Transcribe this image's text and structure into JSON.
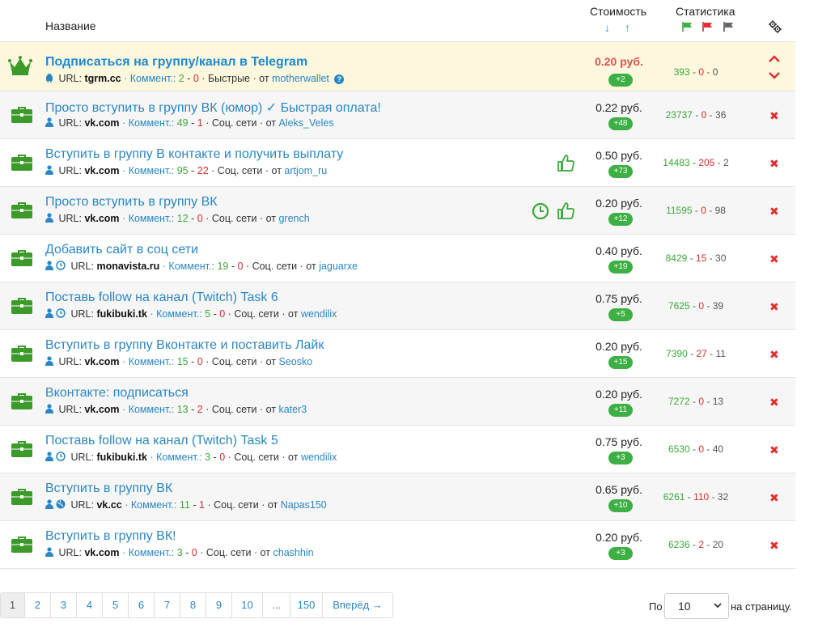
{
  "header": {
    "name_label": "Название",
    "cost_label": "Стоимость",
    "stats_label": "Статистика",
    "sort_down": "↓",
    "sort_up": "↑"
  },
  "promo": {
    "title": "Подписаться на группу/канал в Telegram",
    "url_label": "URL:",
    "url": "tgrm.cc",
    "comments_label": "Коммент.:",
    "comments_good": "2",
    "sep": " - ",
    "comments_bad": "0",
    "category": "Быстрые",
    "from_label": "от",
    "author": "motherwallet",
    "help": "?",
    "price": "0.20 руб.",
    "badge": "+2",
    "stat_ok": "393",
    "stat_bad": "0",
    "stat_neutral": "0"
  },
  "rows": [
    {
      "title": "Просто вступить в группу ВК (юмор) ✓ Быстрая оплата!",
      "url": "vk.com",
      "c_good": "49",
      "c_bad": "1",
      "category": "Соц. сети",
      "author": "Aleks_Veles",
      "price": "0.22 руб.",
      "badge": "+48",
      "s_ok": "23737",
      "s_bad": "0",
      "s_n": "36"
    },
    {
      "title": "Вступить в группу В контакте и получить выплату",
      "url": "vk.com",
      "c_good": "95",
      "c_bad": "22",
      "category": "Соц. сети",
      "author": "artjom_ru",
      "price": "0.50 руб.",
      "badge": "+73",
      "s_ok": "14483",
      "s_bad": "205",
      "s_n": "2"
    },
    {
      "title": "Просто вступить в группу ВК",
      "url": "vk.com",
      "c_good": "12",
      "c_bad": "0",
      "category": "Соц. сети",
      "author": "grench",
      "price": "0.20 руб.",
      "badge": "+12",
      "s_ok": "11595",
      "s_bad": "0",
      "s_n": "98"
    },
    {
      "title": "Добавить сайт в соц сети",
      "url": "monavista.ru",
      "c_good": "19",
      "c_bad": "0",
      "category": "Соц. сети",
      "author": "jaguarxe",
      "price": "0.40 руб.",
      "badge": "+19",
      "s_ok": "8429",
      "s_bad": "15",
      "s_n": "30"
    },
    {
      "title": "Поставь follow на канал (Twitch) Task 6",
      "url": "fukibuki.tk",
      "c_good": "5",
      "c_bad": "0",
      "category": "Соц. сети",
      "author": "wendilix",
      "price": "0.75 руб.",
      "badge": "+5",
      "s_ok": "7625",
      "s_bad": "0",
      "s_n": "39"
    },
    {
      "title": "Вступить в группу Вконтакте и поставить Лайк",
      "url": "vk.com",
      "c_good": "15",
      "c_bad": "0",
      "category": "Соц. сети",
      "author": "Seosko",
      "price": "0.20 руб.",
      "badge": "+15",
      "s_ok": "7390",
      "s_bad": "27",
      "s_n": "11"
    },
    {
      "title": "Вконтакте: подписаться",
      "url": "vk.com",
      "c_good": "13",
      "c_bad": "2",
      "category": "Соц. сети",
      "author": "kater3",
      "price": "0.20 руб.",
      "badge": "+11",
      "s_ok": "7272",
      "s_bad": "0",
      "s_n": "13"
    },
    {
      "title": "Поставь follow на канал (Twitch) Task 5",
      "url": "fukibuki.tk",
      "c_good": "3",
      "c_bad": "0",
      "category": "Соц. сети",
      "author": "wendilix",
      "price": "0.75 руб.",
      "badge": "+3",
      "s_ok": "6530",
      "s_bad": "0",
      "s_n": "40"
    },
    {
      "title": "Вступить в группу ВК",
      "url": "vk.cc",
      "c_good": "11",
      "c_bad": "1",
      "category": "Соц. сети",
      "author": "Napas150",
      "price": "0.65 руб.",
      "badge": "+10",
      "s_ok": "6261",
      "s_bad": "110",
      "s_n": "32"
    },
    {
      "title": "Вступить в группу ВК!",
      "url": "vk.com",
      "c_good": "3",
      "c_bad": "0",
      "category": "Соц. сети",
      "author": "chashhin",
      "price": "0.20 руб.",
      "badge": "+3",
      "s_ok": "6236",
      "s_bad": "2",
      "s_n": "20"
    }
  ],
  "labels": {
    "url_label": "URL:",
    "comments_label": "Коммент.:",
    "from_label": "от",
    "sep": " - "
  },
  "pagination": {
    "pages": [
      "1",
      "2",
      "3",
      "4",
      "5",
      "6",
      "7",
      "8",
      "9",
      "10",
      "...",
      "150",
      "Вперёд →"
    ],
    "active": "1"
  },
  "perpage": {
    "prefix": "По",
    "value": "10",
    "suffix": "на страницу."
  },
  "colors": {
    "link": "#2a86c5",
    "badge": "#3cb043",
    "ok": "#3aa83a",
    "bad": "#d32f2f",
    "promo_bg": "#fcf7dd"
  }
}
